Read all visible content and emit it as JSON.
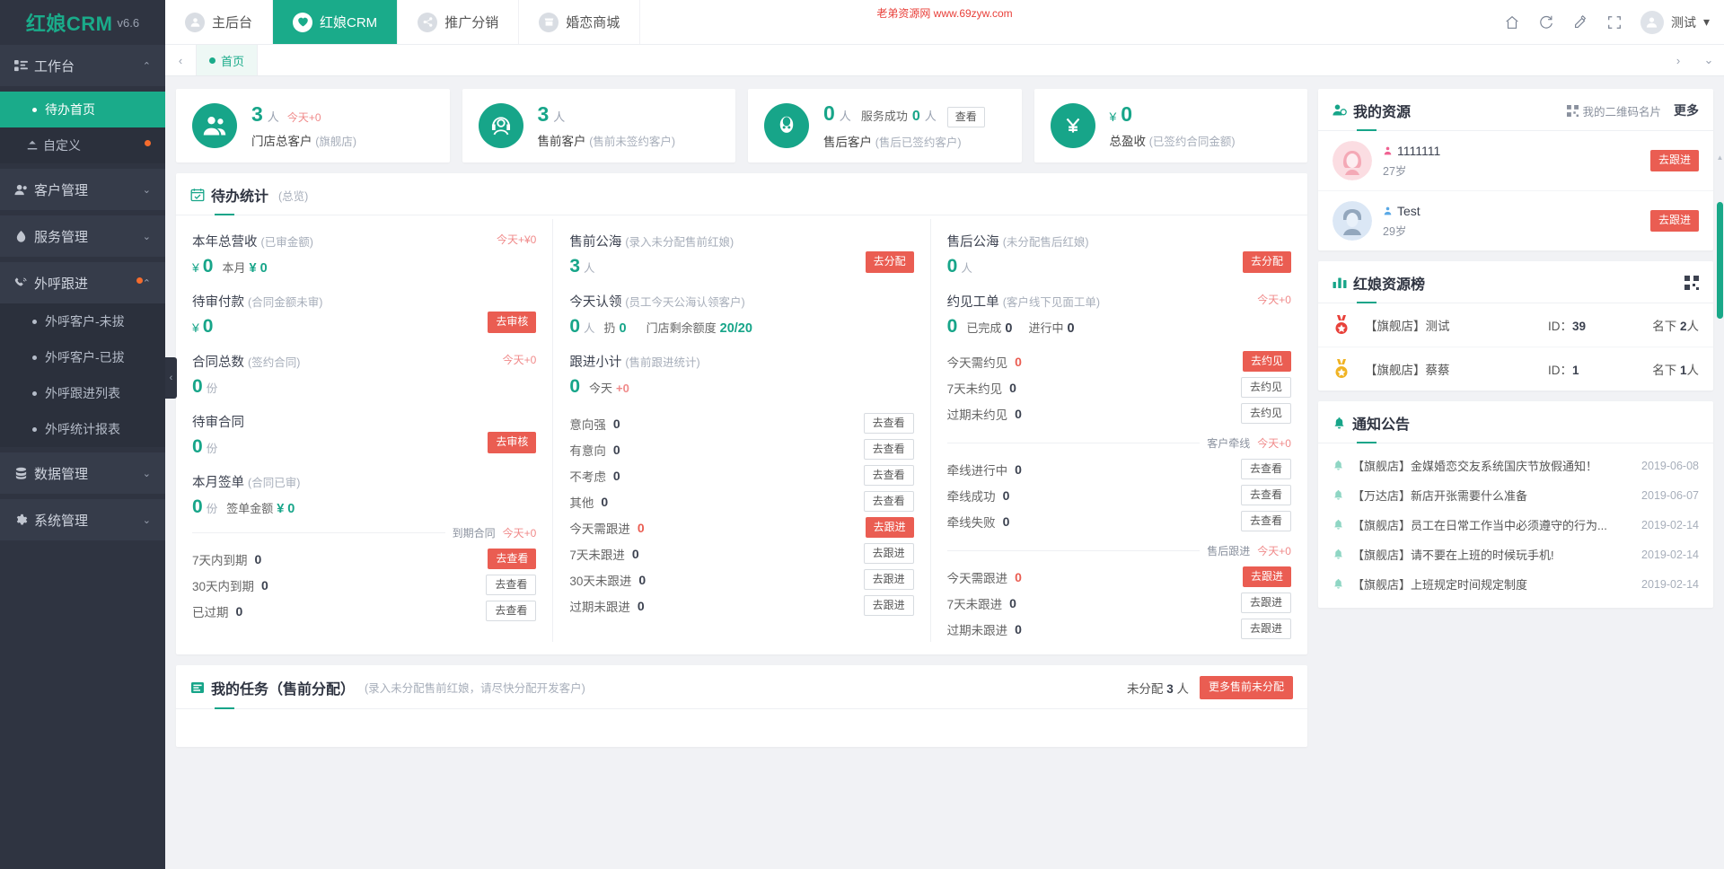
{
  "brand": {
    "name": "红娘CRM",
    "version": "v6.6"
  },
  "sidebar": {
    "items": [
      {
        "label": "工作台",
        "icon": "dashboard-icon",
        "arrow": "⌃",
        "type": "group",
        "dot": false
      },
      {
        "label": "待办首页",
        "icon": "dot",
        "type": "sub",
        "active": true
      },
      {
        "label": "自定义",
        "icon": "custom-icon",
        "type": "sub2",
        "dot": true
      },
      {
        "label": "客户管理",
        "icon": "user-icon",
        "arrow": "⌄",
        "type": "group",
        "dot": false
      },
      {
        "label": "服务管理",
        "icon": "service-icon",
        "arrow": "⌄",
        "type": "group",
        "dot": false
      },
      {
        "label": "外呼跟进",
        "icon": "phone-icon",
        "arrow": "⌃",
        "type": "group",
        "dot": true
      },
      {
        "label": "外呼客户-未拔",
        "type": "sub"
      },
      {
        "label": "外呼客户-已拔",
        "type": "sub"
      },
      {
        "label": "外呼跟进列表",
        "type": "sub"
      },
      {
        "label": "外呼统计报表",
        "type": "sub"
      },
      {
        "label": "数据管理",
        "icon": "data-icon",
        "arrow": "⌄",
        "type": "group",
        "dot": false
      },
      {
        "label": "系统管理",
        "icon": "gear-icon",
        "arrow": "⌄",
        "type": "group",
        "dot": false
      }
    ],
    "collapse_handle": "‹"
  },
  "topbar": {
    "tabs": [
      {
        "label": "主后台",
        "icon": "user-circle-icon",
        "active": false
      },
      {
        "label": "红娘CRM",
        "icon": "crm-icon",
        "active": true
      },
      {
        "label": "推广分销",
        "icon": "share-icon",
        "active": false
      },
      {
        "label": "婚恋商城",
        "icon": "shop-icon",
        "active": false
      }
    ],
    "watermark_line1": "老弟资源网 www.69zyw.com",
    "icons": [
      "home-icon",
      "refresh-icon",
      "theme-icon",
      "fullscreen-icon"
    ],
    "user": {
      "name": "测试",
      "caret": "▾"
    }
  },
  "tabbar": {
    "prev": "‹",
    "next": "›",
    "more": "⌄",
    "tabs": [
      {
        "label": "首页",
        "active": true
      }
    ]
  },
  "stats": [
    {
      "icon": "users-icon",
      "num": "3",
      "unit": "人",
      "today": "今天+0",
      "title": "门店总客户",
      "sub": "(旗舰店)"
    },
    {
      "icon": "headset-icon",
      "num": "3",
      "unit": "人",
      "today": "",
      "title": "售前客户",
      "sub": "(售前未签约客户)"
    },
    {
      "icon": "avatar-icon",
      "num": "0",
      "unit": "人",
      "mid_label": "服务成功",
      "mid_num": "0",
      "mid_unit": "人",
      "button": "查看",
      "title": "售后客户",
      "sub": "(售后已签约客户)"
    },
    {
      "icon": "yen-icon",
      "yen": "¥",
      "num": "0",
      "title": "总盈收",
      "sub": "(已签约合同金额)"
    }
  ],
  "todo_panel": {
    "title": "待办统计",
    "sub": "(总览)",
    "icon": "calendar-check-icon",
    "col1": [
      {
        "title": "本年总营收",
        "sub": "(已审金额)",
        "yen": "¥",
        "value": "0",
        "extra_label": "本月",
        "extra_yen": "¥",
        "extra_value": "0",
        "corner_today": "今天+¥0"
      },
      {
        "title": "待审付款",
        "sub": "(合同金额未审)",
        "yen": "¥",
        "value": "0",
        "corner_btn": "去审核"
      },
      {
        "title": "合同总数",
        "sub": "(签约合同)",
        "value": "0",
        "unit": "份",
        "corner_today": "今天+0"
      },
      {
        "title": "待审合同",
        "sub": "",
        "value": "0",
        "unit": "份",
        "corner_btn": "去审核"
      },
      {
        "title": "本月签单",
        "sub": "(合同已审)",
        "value": "0",
        "unit": "份",
        "extra_label": "签单金额",
        "extra_yen": "¥",
        "extra_value": "0"
      }
    ],
    "col1_divider": {
      "label": "到期合同",
      "today": "今天+0"
    },
    "col1_rows": [
      {
        "name": "7天内到期",
        "num": "0",
        "btn": "去查看",
        "btn_style": "red"
      },
      {
        "name": "30天内到期",
        "num": "0",
        "btn": "去查看",
        "btn_style": "ghost"
      },
      {
        "name": "已过期",
        "num": "0",
        "btn": "去查看",
        "btn_style": "ghost"
      }
    ],
    "col2": [
      {
        "title": "售前公海",
        "sub": "(录入未分配售前红娘)",
        "value": "3",
        "unit": "人",
        "corner_btn": "去分配"
      },
      {
        "title": "今天认领",
        "sub": "(员工今天公海认领客户)",
        "value": "0",
        "unit": "人",
        "mid_label": "扔",
        "mid_value": "0",
        "extra_label": "门店剩余额度",
        "extra_value": "20/20"
      },
      {
        "title": "跟进小计",
        "sub": "(售前跟进统计)",
        "value": "0",
        "extra_label": "今天",
        "today_plus": "+0"
      }
    ],
    "col2_rows": [
      {
        "name": "意向强",
        "num": "0",
        "btn": "去查看",
        "btn_style": "ghost"
      },
      {
        "name": "有意向",
        "num": "0",
        "btn": "去查看",
        "btn_style": "ghost"
      },
      {
        "name": "不考虑",
        "num": "0",
        "btn": "去查看",
        "btn_style": "ghost"
      },
      {
        "name": "其他",
        "num": "0",
        "btn": "去查看",
        "btn_style": "ghost"
      },
      {
        "name": "今天需跟进",
        "num": "0",
        "num_red": true,
        "btn": "去跟进",
        "btn_style": "red"
      },
      {
        "name": "7天未跟进",
        "num": "0",
        "btn": "去跟进",
        "btn_style": "ghost"
      },
      {
        "name": "30天未跟进",
        "num": "0",
        "btn": "去跟进",
        "btn_style": "ghost"
      },
      {
        "name": "过期未跟进",
        "num": "0",
        "btn": "去跟进",
        "btn_style": "ghost"
      }
    ],
    "col3": [
      {
        "title": "售后公海",
        "sub": "(未分配售后红娘)",
        "value": "0",
        "unit": "人",
        "corner_btn": "去分配"
      },
      {
        "title": "约见工单",
        "sub": "(客户线下见面工单)",
        "value": "0",
        "mid_label": "已完成",
        "mid_value": "0",
        "extra_label": "进行中",
        "extra_value": "0",
        "corner_today": "今天+0"
      }
    ],
    "col3_rows_a": [
      {
        "name": "今天需约见",
        "num": "0",
        "num_red": true,
        "btn": "去约见",
        "btn_style": "red"
      },
      {
        "name": "7天未约见",
        "num": "0",
        "btn": "去约见",
        "btn_style": "ghost"
      },
      {
        "name": "过期未约见",
        "num": "0",
        "btn": "去约见",
        "btn_style": "ghost"
      }
    ],
    "col3_divider_a": {
      "label": "客户牵线",
      "today": "今天+0"
    },
    "col3_rows_b": [
      {
        "name": "牵线进行中",
        "num": "0",
        "btn": "去查看",
        "btn_style": "ghost"
      },
      {
        "name": "牵线成功",
        "num": "0",
        "btn": "去查看",
        "btn_style": "ghost"
      },
      {
        "name": "牵线失败",
        "num": "0",
        "btn": "去查看",
        "btn_style": "ghost"
      }
    ],
    "col3_divider_b": {
      "label": "售后跟进",
      "today": "今天+0"
    },
    "col3_rows_c": [
      {
        "name": "今天需跟进",
        "num": "0",
        "num_red": true,
        "btn": "去跟进",
        "btn_style": "red"
      },
      {
        "name": "7天未跟进",
        "num": "0",
        "btn": "去跟进",
        "btn_style": "ghost"
      },
      {
        "name": "过期未跟进",
        "num": "0",
        "btn": "去跟进",
        "btn_style": "ghost"
      }
    ]
  },
  "task_panel": {
    "icon": "task-icon",
    "title": "我的任务（售前分配）",
    "sub": "(录入未分配售前红娘，请尽快分配开发客户)",
    "unassigned_label": "未分配",
    "unassigned_num": "3",
    "unassigned_unit": "人",
    "more_btn": "更多售前未分配"
  },
  "my_resource": {
    "icon": "resource-icon",
    "title": "我的资源",
    "qr_label": "我的二维码名片",
    "qr_icon": "qr-icon",
    "more": "更多",
    "items": [
      {
        "name": "1111111",
        "age": "27岁",
        "sex": "female",
        "btn": "去跟进",
        "avatar": "female"
      },
      {
        "name": "Test",
        "age": "29岁",
        "sex": "male",
        "btn": "去跟进",
        "avatar": "male"
      }
    ]
  },
  "rank_panel": {
    "icon": "bar-chart-icon",
    "title": "红娘资源榜",
    "qr_icon": "qr-icon",
    "items": [
      {
        "medal": "gold-red",
        "name": "【旗舰店】测试",
        "id_label": "ID：",
        "id": "39",
        "count_label": "名下",
        "count": "2",
        "count_unit": "人"
      },
      {
        "medal": "gold-yellow",
        "name": "【旗舰店】蔡蔡",
        "id_label": "ID：",
        "id": "1",
        "count_label": "名下",
        "count": "1",
        "count_unit": "人"
      }
    ]
  },
  "notice_panel": {
    "icon": "bell-icon",
    "title": "通知公告",
    "items": [
      {
        "text": "【旗舰店】金媒婚恋交友系统国庆节放假通知！",
        "date": "2019-06-08"
      },
      {
        "text": "【万达店】新店开张需要什么准备",
        "date": "2019-06-07"
      },
      {
        "text": "【旗舰店】员工在日常工作当中必须遵守的行为...",
        "date": "2019-02-14"
      },
      {
        "text": "【旗舰店】请不要在上班的时候玩手机!",
        "date": "2019-02-14"
      },
      {
        "text": "【旗舰店】上班规定时间规定制度",
        "date": "2019-02-14"
      }
    ]
  },
  "colors": {
    "accent": "#17a589",
    "sidebar": "#2f3441",
    "danger": "#ea5d52",
    "muted": "#a7aeba"
  }
}
